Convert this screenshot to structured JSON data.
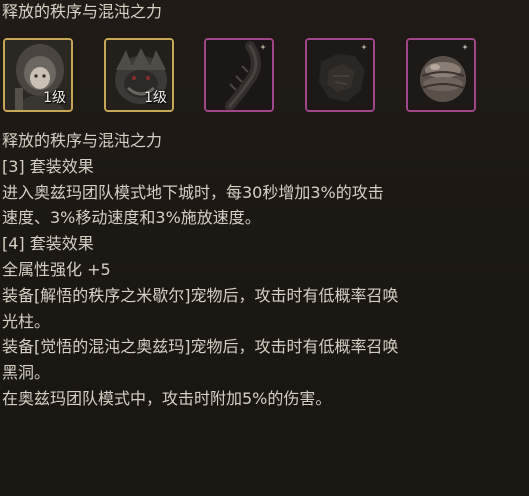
{
  "set_title": "释放的秩序与混沌之力",
  "slots": [
    {
      "icon": "hooded-figure-icon",
      "rarity_color": "#c9a656",
      "level": "1级"
    },
    {
      "icon": "dark-beast-icon",
      "rarity_color": "#c9a656",
      "level": "1级"
    },
    {
      "icon": "dark-claw-icon",
      "rarity_color": "#a0468c",
      "level": ""
    },
    {
      "icon": "dark-armor-icon",
      "rarity_color": "#a0468c",
      "level": ""
    },
    {
      "icon": "dark-orb-icon",
      "rarity_color": "#a0468c",
      "level": ""
    }
  ],
  "description": {
    "set_name": "释放的秩序与混沌之力",
    "lines": [
      "[3] 套装效果",
      "进入奥兹玛团队模式地下城时，每30秒增加3%的攻击",
      "速度、3%移动速度和3%施放速度。",
      "[4] 套装效果",
      "全属性强化 +5",
      "装备[解悟的秩序之米歇尔]宠物后，攻击时有低概率召唤",
      "光柱。",
      "装备[觉悟的混沌之奥兹玛]宠物后，攻击时有低概率召唤",
      "黑洞。",
      "在奥兹玛团队模式中，攻击时附加5%的伤害。"
    ]
  }
}
